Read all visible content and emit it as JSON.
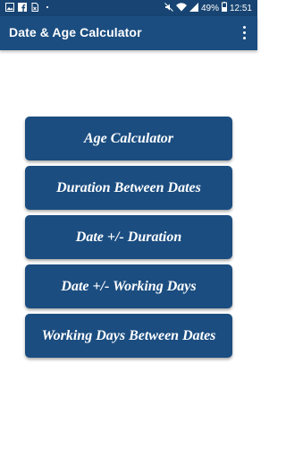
{
  "status_bar": {
    "left_icons": [
      "image-icon",
      "facebook-icon",
      "sim-icon",
      "dots-icon"
    ],
    "battery_text": "49%",
    "time": "12:51"
  },
  "app_bar": {
    "title": "Date & Age Calculator"
  },
  "menu": {
    "items": [
      {
        "label": "Age Calculator"
      },
      {
        "label": "Duration Between Dates"
      },
      {
        "label": "Date +/- Duration"
      },
      {
        "label": "Date +/- Working Days"
      },
      {
        "label": "Working Days Between Dates"
      }
    ]
  },
  "colors": {
    "primary": "#1b4d80",
    "status_bar": "#174472",
    "background": "#ffffff",
    "text_on_primary": "#ffffff"
  }
}
